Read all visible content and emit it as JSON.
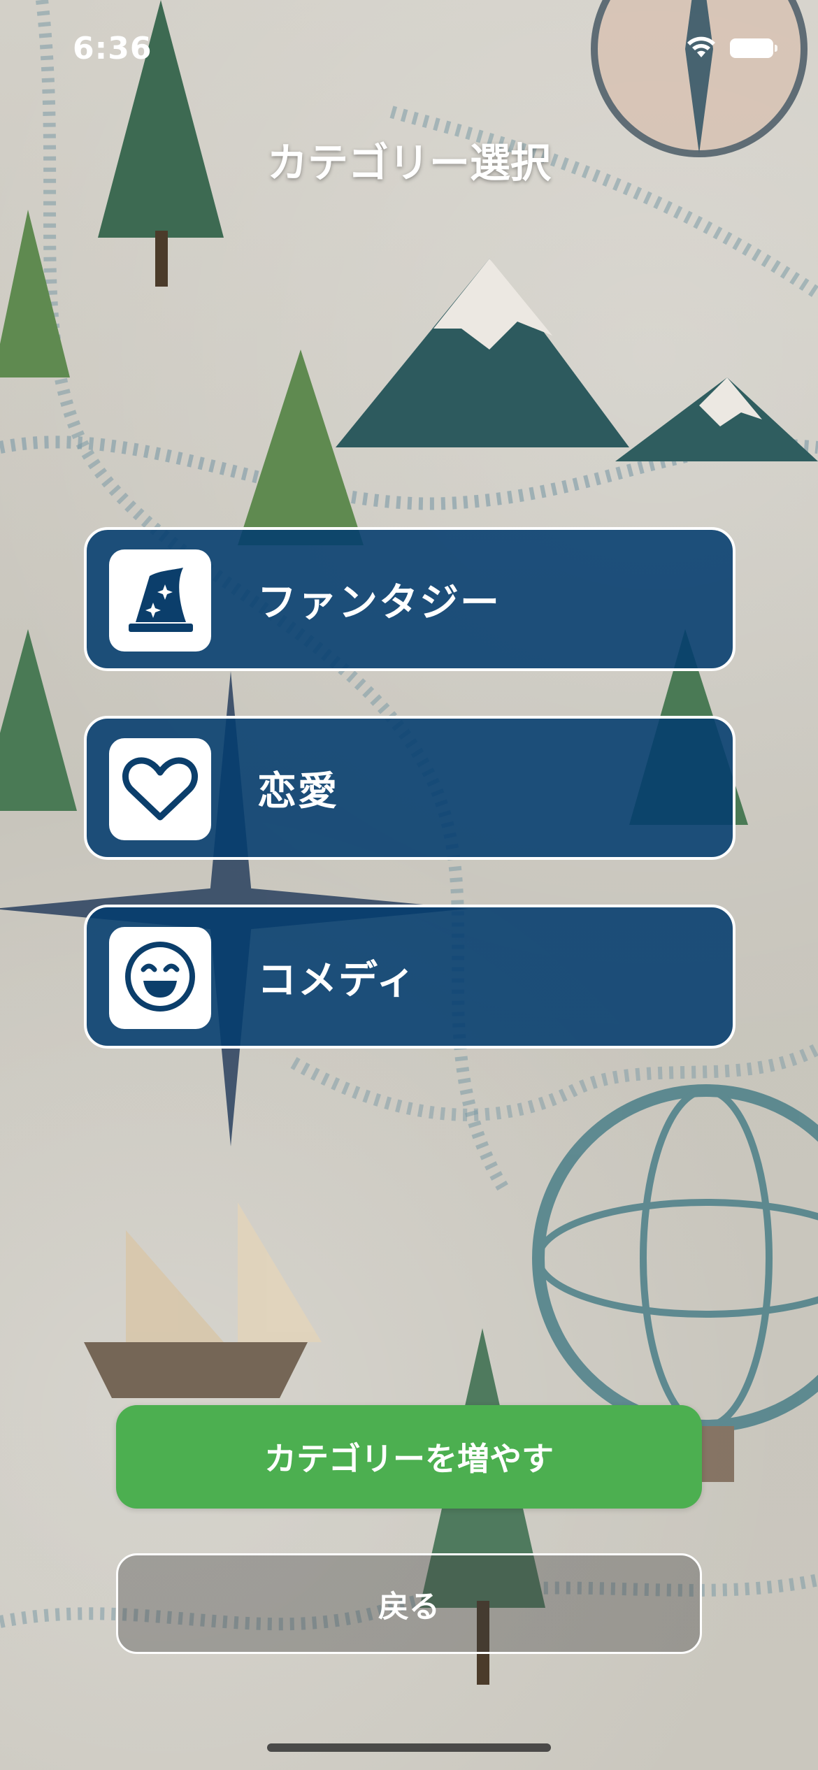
{
  "status_bar": {
    "time": "6:36",
    "wifi_icon": "wifi-icon",
    "battery_icon": "battery-icon"
  },
  "header": {
    "title": "カテゴリー選択"
  },
  "categories": [
    {
      "label": "ファンタジー",
      "icon": "wizard-hat-icon"
    },
    {
      "label": "恋愛",
      "icon": "heart-icon"
    },
    {
      "label": "コメディ",
      "icon": "smiley-face-icon"
    }
  ],
  "actions": {
    "add_category_label": "カテゴリーを増やす",
    "back_label": "戻る"
  },
  "colors": {
    "category_bg": "#033c6e",
    "icon_color": "#0b3e6b",
    "primary_button": "#4caf50",
    "background": "#c9c6bd"
  }
}
